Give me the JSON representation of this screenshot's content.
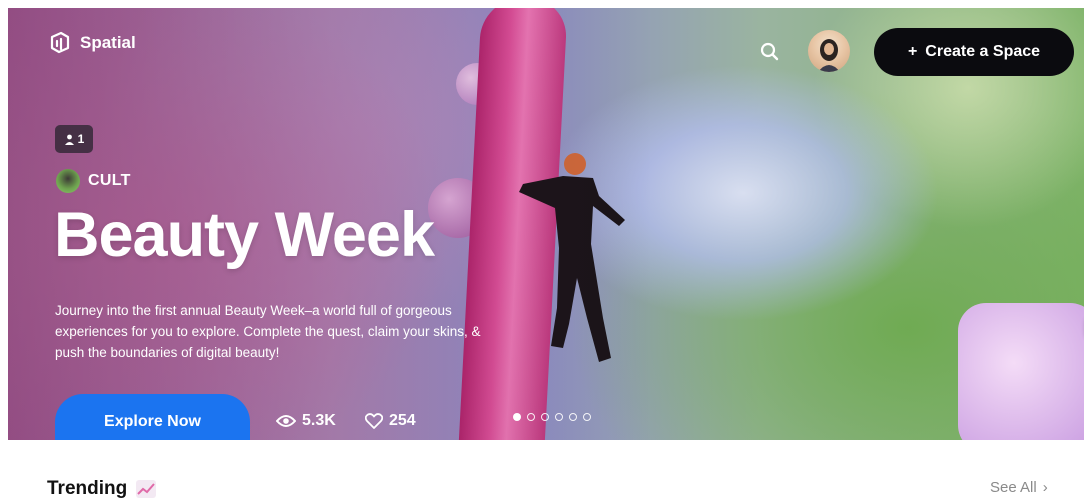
{
  "brand": {
    "name": "Spatial",
    "logo_icon": "spatial-logo-icon"
  },
  "header": {
    "search_icon": "search-icon",
    "create_label": "Create a Space",
    "create_icon": "plus-icon"
  },
  "hero": {
    "visitor_badge_count": "1",
    "creator_name": "CULT",
    "title": "Beauty Week",
    "description": "Journey into the first annual Beauty Week–a world full of gorgeous experiences for you to explore. Complete the quest, claim your skins, & push the boundaries of digital beauty!",
    "cta_label": "Explore Now",
    "views": "5.3K",
    "likes": "254",
    "carousel": {
      "total": 6,
      "active_index": 0
    }
  },
  "trending": {
    "title": "Trending",
    "see_all_label": "See All"
  },
  "colors": {
    "primary_blue": "#1b74f0",
    "create_button": "#0b0b0f",
    "text_dark": "#111111",
    "text_muted": "#8a8a8a"
  }
}
